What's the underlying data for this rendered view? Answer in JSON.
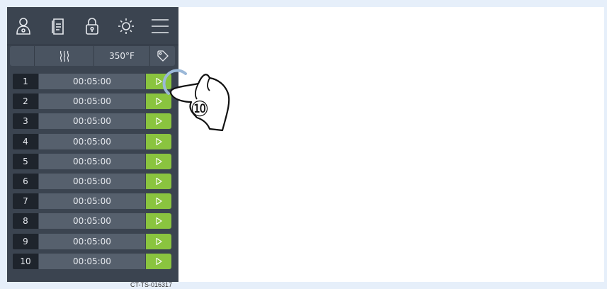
{
  "toolbar": {
    "icons": [
      "user-icon",
      "recipe-book-icon",
      "lock-icon",
      "brightness-icon",
      "menu-icon"
    ]
  },
  "status": {
    "heat_icon": "heat-waves-icon",
    "temperature": "350°F",
    "tag_icon": "tag-icon"
  },
  "timers": [
    {
      "num": "1",
      "time": "00:05:00"
    },
    {
      "num": "2",
      "time": "00:05:00"
    },
    {
      "num": "3",
      "time": "00:05:00"
    },
    {
      "num": "4",
      "time": "00:05:00"
    },
    {
      "num": "5",
      "time": "00:05:00"
    },
    {
      "num": "6",
      "time": "00:05:00"
    },
    {
      "num": "7",
      "time": "00:05:00"
    },
    {
      "num": "8",
      "time": "00:05:00"
    },
    {
      "num": "9",
      "time": "00:05:00"
    },
    {
      "num": "10",
      "time": "00:05:00"
    }
  ],
  "annotation": {
    "step": "⑩",
    "doc_code": "CT-TS-016317"
  },
  "colors": {
    "panel": "#3b4450",
    "play_green": "#8ac43f",
    "timer_bg": "#56606d"
  }
}
